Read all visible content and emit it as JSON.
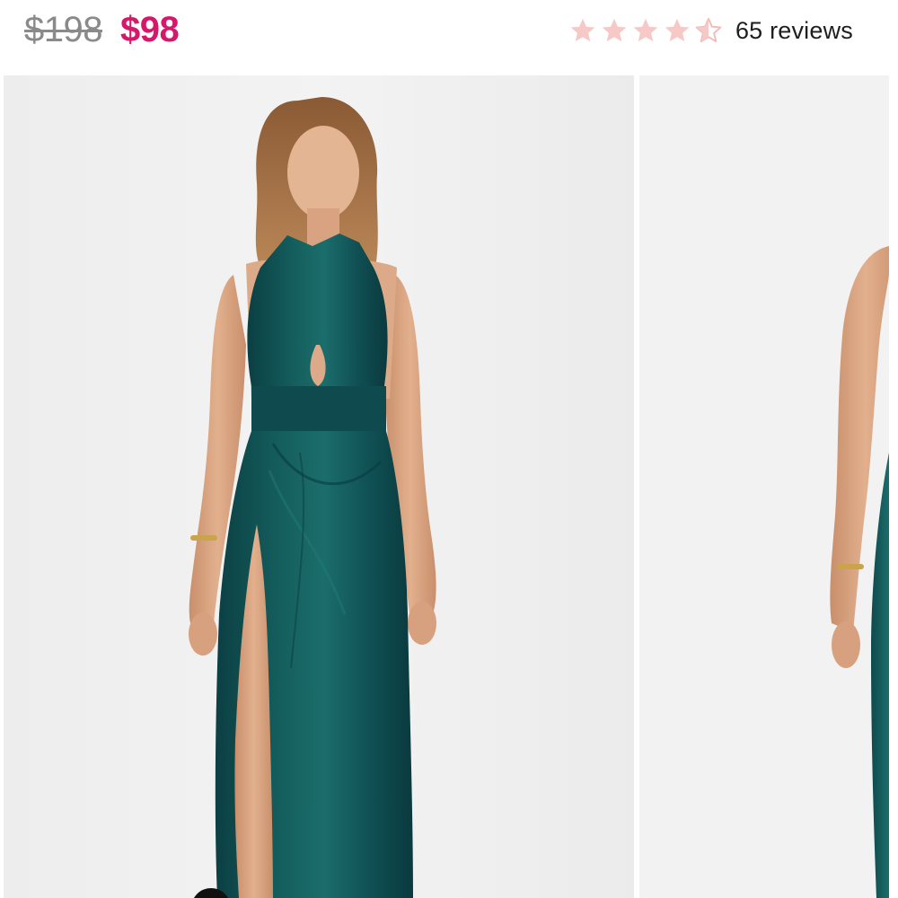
{
  "product": {
    "price_original": "$198",
    "price_sale": "$98",
    "rating_value": 4.5,
    "rating_max": 5,
    "reviews_label": "65 reviews"
  },
  "colors": {
    "sale_price": "#d6186b",
    "original_price": "#8a8a8a",
    "star_fill": "#f6c9c6",
    "dress": "#0f4e52"
  },
  "icons": {
    "star": "star-icon",
    "half_star": "half-star-icon"
  },
  "gallery": {
    "images": [
      {
        "name": "model-front-view"
      },
      {
        "name": "model-back-view"
      }
    ]
  }
}
